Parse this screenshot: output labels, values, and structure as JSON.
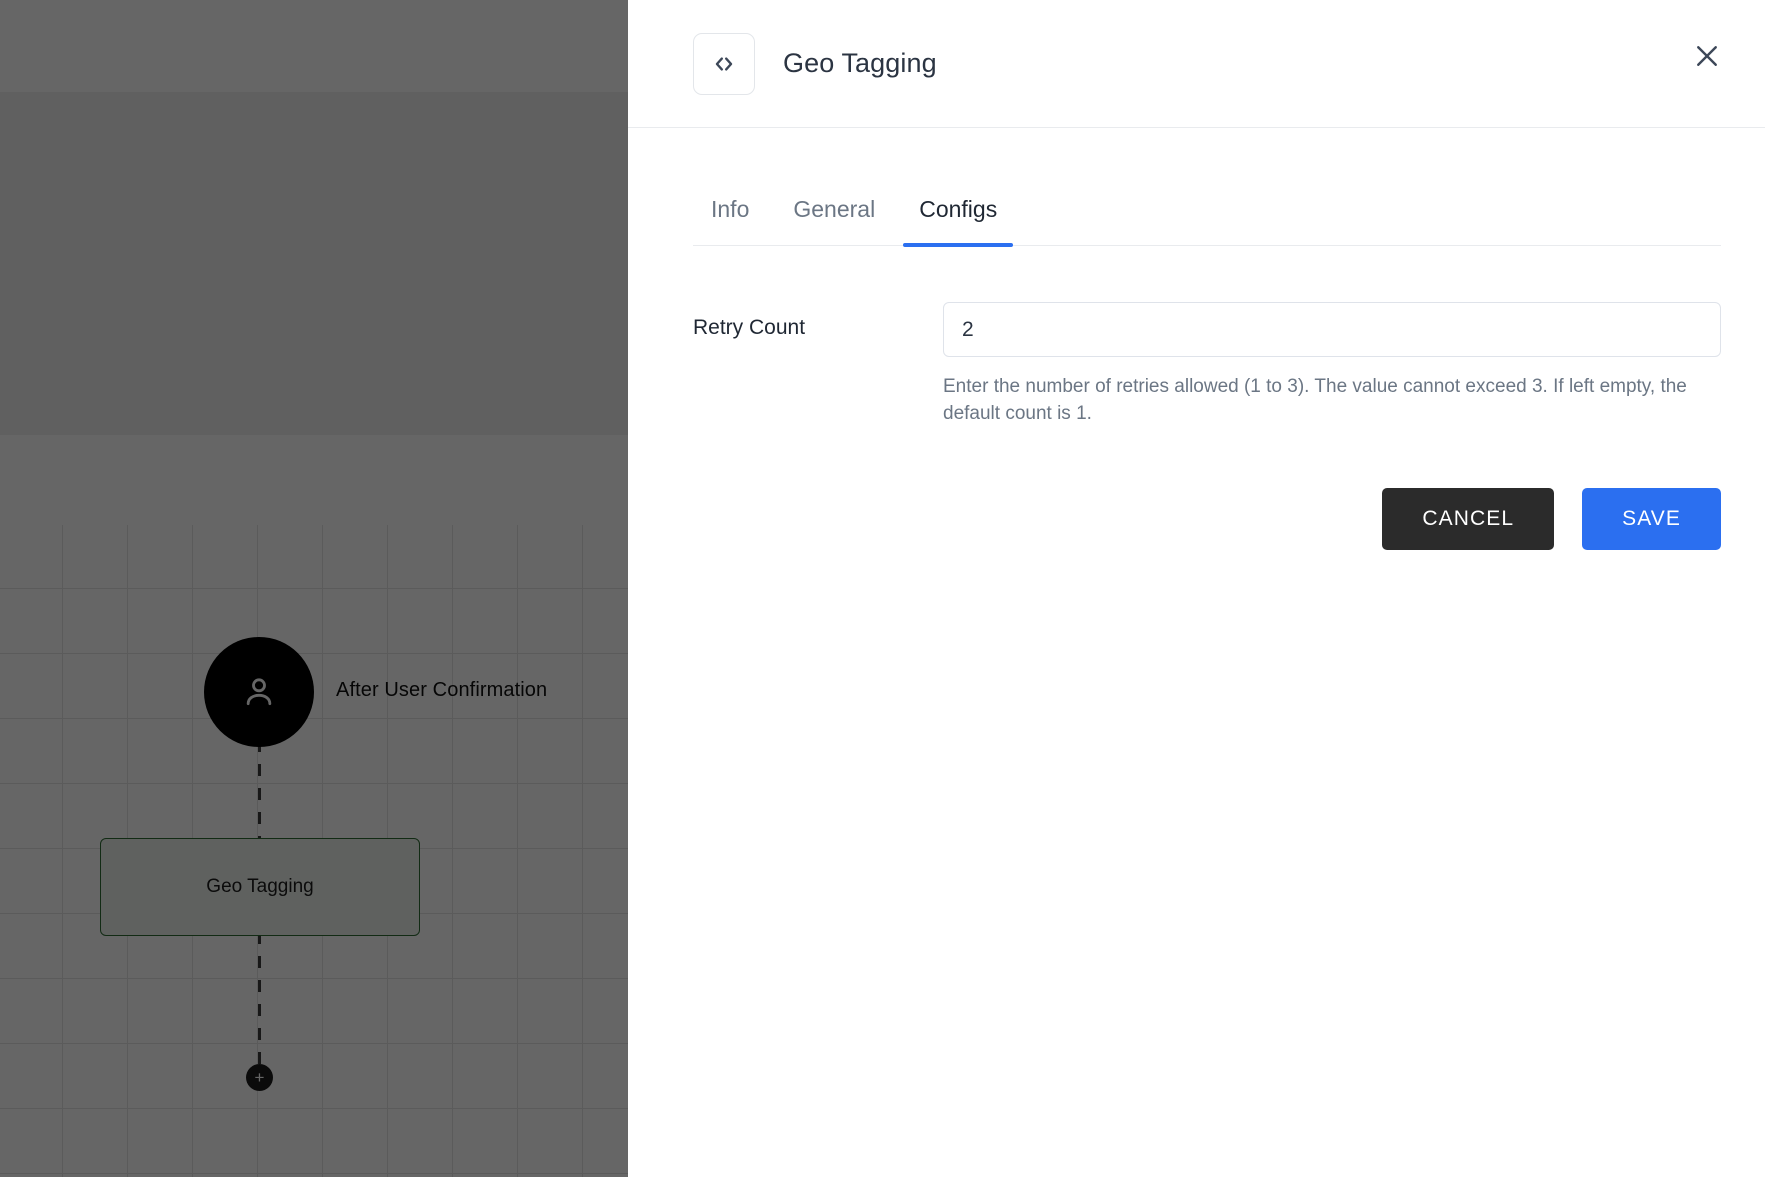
{
  "canvas": {
    "trigger": {
      "label": "After User Confirmation",
      "icon": "user-icon"
    },
    "step": {
      "label": "Geo Tagging"
    },
    "add_step": {
      "label": "+"
    }
  },
  "drawer": {
    "icon": "code-brackets-icon",
    "title": "Geo Tagging",
    "close_icon": "close-icon",
    "tabs": [
      {
        "label": "Info",
        "active": false
      },
      {
        "label": "General",
        "active": false
      },
      {
        "label": "Configs",
        "active": true
      }
    ],
    "fields": [
      {
        "label": "Retry Count",
        "value": "2",
        "placeholder": "",
        "help": "Enter the number of retries allowed (1 to 3). The value cannot exceed 3. If left empty, the default count is 1."
      }
    ],
    "buttons": {
      "cancel": "CANCEL",
      "save": "SAVE"
    }
  },
  "colors": {
    "accent": "#2b6ff0",
    "cancel": "#2b2b2b",
    "node_border": "#2f6b34",
    "title": "#2b3442",
    "muted": "#6b7684"
  }
}
